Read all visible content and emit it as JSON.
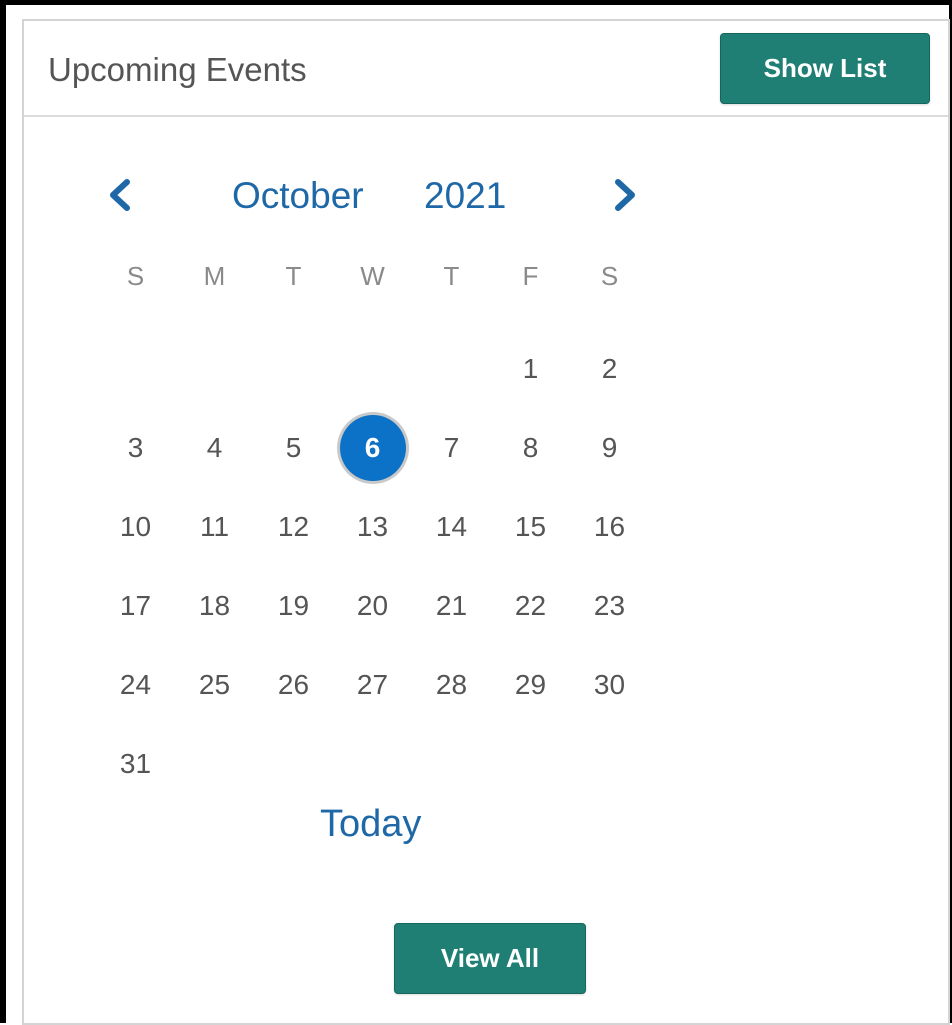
{
  "header": {
    "title": "Upcoming Events",
    "show_list_label": "Show List"
  },
  "calendar": {
    "month": "October",
    "year": "2021",
    "weekdays": [
      "S",
      "M",
      "T",
      "W",
      "T",
      "F",
      "S"
    ],
    "weeks": [
      [
        "",
        "",
        "",
        "",
        "",
        "1",
        "2"
      ],
      [
        "3",
        "4",
        "5",
        "6",
        "7",
        "8",
        "9"
      ],
      [
        "10",
        "11",
        "12",
        "13",
        "14",
        "15",
        "16"
      ],
      [
        "17",
        "18",
        "19",
        "20",
        "21",
        "22",
        "23"
      ],
      [
        "24",
        "25",
        "26",
        "27",
        "28",
        "29",
        "30"
      ],
      [
        "31",
        "",
        "",
        "",
        "",
        "",
        ""
      ]
    ],
    "selected_day": "6",
    "selected_color": "#0b72c7",
    "today_label": "Today"
  },
  "footer": {
    "view_all_label": "View All"
  },
  "colors": {
    "button_bg": "#1f7f74",
    "link": "#1f68a8"
  },
  "icons": {
    "prev": "chevron-left-icon",
    "next": "chevron-right-icon"
  }
}
